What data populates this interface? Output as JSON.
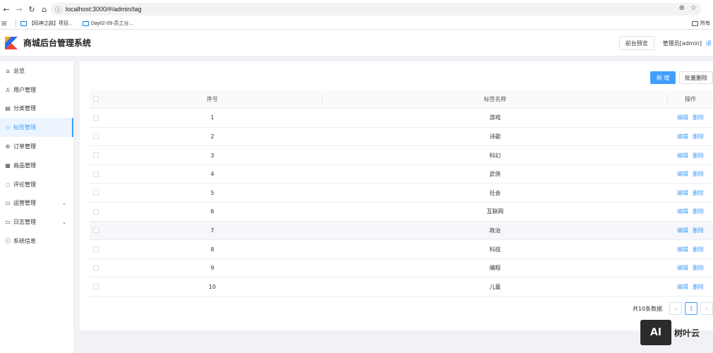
{
  "browser": {
    "url": "localhost:3000/#/admin/tag",
    "bookmarks": [
      "【码神之路】项目...",
      "Day02-09-员工分..."
    ],
    "bookmark_right": "所有"
  },
  "header": {
    "title": "商城后台管理系统",
    "preview_label": "前台预览",
    "admin_label": "管理员[admin]",
    "logout_label": "退"
  },
  "sidebar": {
    "items": [
      {
        "label": "总览",
        "icon": "home-icon"
      },
      {
        "label": "用户管理",
        "icon": "user-icon"
      },
      {
        "label": "分类管理",
        "icon": "category-icon"
      },
      {
        "label": "标签管理",
        "icon": "tag-icon"
      },
      {
        "label": "订单管理",
        "icon": "order-icon"
      },
      {
        "label": "商品管理",
        "icon": "goods-icon"
      },
      {
        "label": "评论管理",
        "icon": "comment-icon"
      },
      {
        "label": "运营管理",
        "icon": "folder-icon"
      },
      {
        "label": "日志管理",
        "icon": "folder-icon"
      },
      {
        "label": "系统信息",
        "icon": "info-icon"
      }
    ],
    "active_index": 3
  },
  "toolbar": {
    "add_label": "新 增",
    "batch_delete_label": "批量删除"
  },
  "table": {
    "headers": [
      "序号",
      "标签名称",
      "操作"
    ],
    "rows": [
      {
        "idx": "1",
        "name": "游戏"
      },
      {
        "idx": "2",
        "name": "诗歌"
      },
      {
        "idx": "3",
        "name": "科幻"
      },
      {
        "idx": "4",
        "name": "武侠"
      },
      {
        "idx": "5",
        "name": "社会"
      },
      {
        "idx": "6",
        "name": "互联网"
      },
      {
        "idx": "7",
        "name": "政治"
      },
      {
        "idx": "8",
        "name": "科技"
      },
      {
        "idx": "9",
        "name": "编程"
      },
      {
        "idx": "10",
        "name": "儿童"
      }
    ],
    "edit_label": "编辑",
    "delete_label": "删除",
    "highlight_row": 6
  },
  "pager": {
    "total_text": "共10条数据",
    "current_page": "1",
    "prev": "‹",
    "next": "›"
  },
  "watermark": {
    "box": "AI",
    "text": "树叶云"
  },
  "colors": {
    "primary": "#409eff",
    "logo_orange": "#f5a623",
    "logo_blue": "#2d6cdf"
  }
}
